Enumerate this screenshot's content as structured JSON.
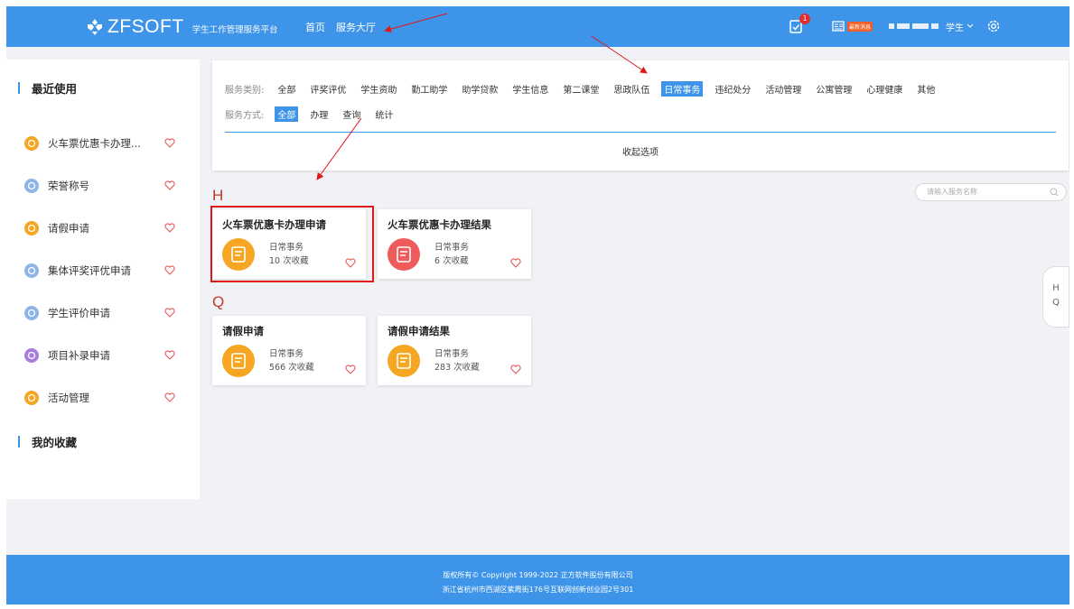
{
  "header": {
    "logo_text": "ZFSOFT",
    "logo_sub": "学生工作管理服务平台",
    "nav": [
      "首页",
      "服务大厅"
    ],
    "badge_count": "1",
    "news_tag": "最新消息",
    "role": "学生"
  },
  "sidebar": {
    "recent_title": "最近使用",
    "favorites_title": "我的收藏",
    "items": [
      {
        "label": "火车票优惠卡办理...",
        "color": "#f5a623"
      },
      {
        "label": "荣誉称号",
        "color": "#8fb4e8"
      },
      {
        "label": "请假申请",
        "color": "#f5a623"
      },
      {
        "label": "集体评奖评优申请",
        "color": "#8fb4e8"
      },
      {
        "label": "学生评价申请",
        "color": "#8fb4e8"
      },
      {
        "label": "项目补录申请",
        "color": "#a77de0"
      },
      {
        "label": "活动管理",
        "color": "#f5a623"
      }
    ]
  },
  "filter": {
    "category_label": "服务类别:",
    "categories": [
      "全部",
      "评奖评优",
      "学生资助",
      "勤工助学",
      "助学贷款",
      "学生信息",
      "第二课堂",
      "思政队伍",
      "日常事务",
      "违纪处分",
      "活动管理",
      "公寓管理",
      "心理健康",
      "其他"
    ],
    "active_category": 8,
    "mode_label": "服务方式:",
    "modes": [
      "全部",
      "办理",
      "查询",
      "统计"
    ],
    "active_mode": 0,
    "collapse_label": "收起选项"
  },
  "search": {
    "placeholder": "请输入服务名称"
  },
  "groups": [
    {
      "letter": "H",
      "cards": [
        {
          "title": "火车票优惠卡办理申请",
          "category": "日常事务",
          "count": "10 次收藏",
          "icon_color": "#f5a623"
        },
        {
          "title": "火车票优惠卡办理结果",
          "category": "日常事务",
          "count": "6 次收藏",
          "icon_color": "#ef5b5b"
        }
      ]
    },
    {
      "letter": "Q",
      "cards": [
        {
          "title": "请假申请",
          "category": "日常事务",
          "count": "566 次收藏",
          "icon_color": "#f5a623"
        },
        {
          "title": "请假申请结果",
          "category": "日常事务",
          "count": "283 次收藏",
          "icon_color": "#f5a623"
        }
      ]
    }
  ],
  "alpha_index": [
    "H",
    "Q"
  ],
  "footer": {
    "line1": "版权所有© Copyright 1999-2022 正方软件股份有限公司",
    "line2": "浙江省杭州市西湖区紫霞街176号互联网创新创业园2号301"
  },
  "colors": {
    "primary": "#3d94e8",
    "heart": "#e55a5a",
    "highlight": "#e01818"
  }
}
